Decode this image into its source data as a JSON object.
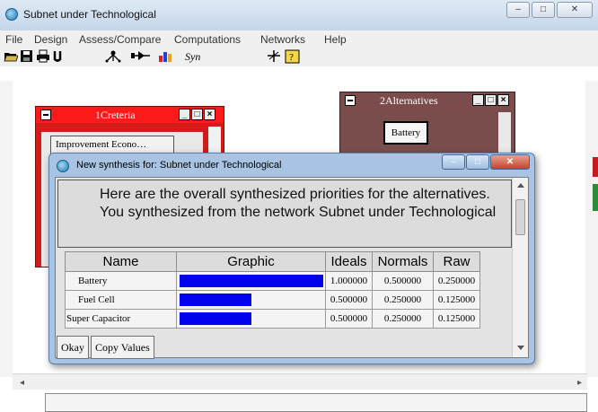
{
  "window": {
    "title": "Subnet under Technological",
    "minimize_glyph": "–",
    "maximize_glyph": "□",
    "close_glyph": "✕"
  },
  "menu": {
    "items": [
      "File",
      "Design",
      "Assess/Compare",
      "Computations",
      "Networks",
      "Help"
    ]
  },
  "toolbar": {
    "icons": [
      "open-icon",
      "save-icon",
      "print-icon",
      "u-icon",
      "add-node-icon",
      "connect-icon",
      "color-chart-icon",
      "synthesize-icon",
      "sensitivity-icon",
      "help-book-icon"
    ],
    "syn_label": "Syn"
  },
  "criteria_window": {
    "title": "1Creteria",
    "button_label": "Improvement Econo…"
  },
  "alternatives_window": {
    "title": "2Alternatives",
    "button_label": "Battery"
  },
  "dialog": {
    "title": "New synthesis for: Subnet under Technological",
    "message": "Here are the overall synthesized priorities for the alternatives.  You synthesized from the network Subnet under Technological",
    "columns": [
      "Name",
      "Graphic",
      "Ideals",
      "Normals",
      "Raw"
    ],
    "rows": [
      {
        "name": "Battery",
        "ideal": "1.000000",
        "normal": "0.500000",
        "raw": "0.250000",
        "bar_fraction": 1.0
      },
      {
        "name": "Fuel Cell",
        "ideal": "0.500000",
        "normal": "0.250000",
        "raw": "0.125000",
        "bar_fraction": 0.5
      },
      {
        "name": "Super Capacitor",
        "ideal": "0.500000",
        "normal": "0.250000",
        "raw": "0.125000",
        "bar_fraction": 0.5
      }
    ],
    "okay_label": "Okay",
    "copy_label": "Copy Values"
  },
  "colors": {
    "bar": "#0000ee",
    "criteria_window": "#d51a1a",
    "alternatives_window": "#7a4d4d"
  }
}
